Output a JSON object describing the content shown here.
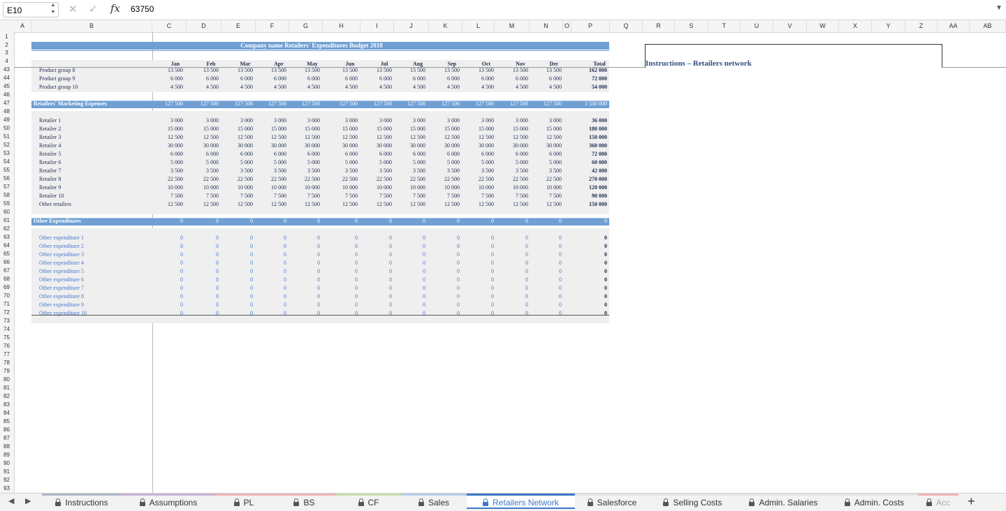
{
  "formula_bar": {
    "cell_ref": "E10",
    "fx": "fx",
    "value": "63750"
  },
  "columns": [
    "A",
    "B",
    "C",
    "D",
    "E",
    "F",
    "G",
    "H",
    "I",
    "J",
    "K",
    "L",
    "M",
    "N",
    "O",
    "P",
    "Q",
    "R",
    "S",
    "T",
    "U",
    "V",
    "W",
    "X",
    "Y",
    "Z",
    "AA",
    "AB",
    "AC"
  ],
  "row_numbers_top": [
    "1",
    "2",
    "3",
    "4"
  ],
  "row_numbers_main": [
    "43",
    "44",
    "45",
    "46",
    "47",
    "48",
    "49",
    "50",
    "51",
    "52",
    "53",
    "54",
    "55",
    "56",
    "57",
    "58",
    "59",
    "60",
    "61",
    "62",
    "63",
    "64",
    "65",
    "66",
    "67",
    "68",
    "69",
    "70",
    "71",
    "72",
    "73",
    "74",
    "75",
    "76",
    "77",
    "78",
    "79",
    "80",
    "81",
    "82",
    "83",
    "84",
    "85",
    "86",
    "87",
    "88",
    "89",
    "90",
    "91",
    "92",
    "93"
  ],
  "title": "Company name Retailers' Expenditures Budget 2018",
  "months": [
    "Jan",
    "Feb",
    "Mar",
    "Apr",
    "May",
    "Jun",
    "Jul",
    "Aug",
    "Sep",
    "Oct",
    "Nov",
    "Dec",
    "Total"
  ],
  "instructions_title": "Instructions – Retailers network",
  "product_rows": [
    {
      "label": "Product group 8",
      "values": [
        "13 500",
        "13 500",
        "13 500",
        "13 500",
        "13 500",
        "13 500",
        "13 500",
        "13 500",
        "13 500",
        "13 500",
        "13 500",
        "13 500",
        "162 000"
      ]
    },
    {
      "label": "Product group 9",
      "values": [
        "6 000",
        "6 000",
        "6 000",
        "6 000",
        "6 000",
        "6 000",
        "6 000",
        "6 000",
        "6 000",
        "6 000",
        "6 000",
        "6 000",
        "72 000"
      ]
    },
    {
      "label": "Product group 10",
      "values": [
        "4 500",
        "4 500",
        "4 500",
        "4 500",
        "4 500",
        "4 500",
        "4 500",
        "4 500",
        "4 500",
        "4 500",
        "4 500",
        "4 500",
        "54 000"
      ]
    }
  ],
  "marketing_header": {
    "label": "Retailers' Marketing Expenses",
    "values": [
      "127 500",
      "127 500",
      "127 500",
      "127 500",
      "127 500",
      "127 500",
      "127 500",
      "127 500",
      "127 500",
      "127 500",
      "127 500",
      "127 500",
      "1 530 000"
    ]
  },
  "retailer_rows": [
    {
      "label": "Retailer 1",
      "values": [
        "3 000",
        "3 000",
        "3 000",
        "3 000",
        "3 000",
        "3 000",
        "3 000",
        "3 000",
        "3 000",
        "3 000",
        "3 000",
        "3 000",
        "36 000"
      ]
    },
    {
      "label": "Retailer 2",
      "values": [
        "15 000",
        "15 000",
        "15 000",
        "15 000",
        "15 000",
        "15 000",
        "15 000",
        "15 000",
        "15 000",
        "15 000",
        "15 000",
        "15 000",
        "180 000"
      ]
    },
    {
      "label": "Retailer 3",
      "values": [
        "12 500",
        "12 500",
        "12 500",
        "12 500",
        "12 500",
        "12 500",
        "12 500",
        "12 500",
        "12 500",
        "12 500",
        "12 500",
        "12 500",
        "150 000"
      ]
    },
    {
      "label": "Retailer 4",
      "values": [
        "30 000",
        "30 000",
        "30 000",
        "30 000",
        "30 000",
        "30 000",
        "30 000",
        "30 000",
        "30 000",
        "30 000",
        "30 000",
        "30 000",
        "360 000"
      ]
    },
    {
      "label": "Retailer 5",
      "values": [
        "6 000",
        "6 000",
        "6 000",
        "6 000",
        "6 000",
        "6 000",
        "6 000",
        "6 000",
        "6 000",
        "6 000",
        "6 000",
        "6 000",
        "72 000"
      ]
    },
    {
      "label": "Retailer 6",
      "values": [
        "5 000",
        "5 000",
        "5 000",
        "5 000",
        "5 000",
        "5 000",
        "5 000",
        "5 000",
        "5 000",
        "5 000",
        "5 000",
        "5 000",
        "60 000"
      ]
    },
    {
      "label": "Retailer 7",
      "values": [
        "3 500",
        "3 500",
        "3 500",
        "3 500",
        "3 500",
        "3 500",
        "3 500",
        "3 500",
        "3 500",
        "3 500",
        "3 500",
        "3 500",
        "42 000"
      ]
    },
    {
      "label": "Retailer 8",
      "values": [
        "22 500",
        "22 500",
        "22 500",
        "22 500",
        "22 500",
        "22 500",
        "22 500",
        "22 500",
        "22 500",
        "22 500",
        "22 500",
        "22 500",
        "270 000"
      ]
    },
    {
      "label": "Retailer 9",
      "values": [
        "10 000",
        "10 000",
        "10 000",
        "10 000",
        "10 000",
        "10 000",
        "10 000",
        "10 000",
        "10 000",
        "10 000",
        "10 000",
        "10 000",
        "120 000"
      ]
    },
    {
      "label": "Retailer 10",
      "values": [
        "7 500",
        "7 500",
        "7 500",
        "7 500",
        "7 500",
        "7 500",
        "7 500",
        "7 500",
        "7 500",
        "7 500",
        "7 500",
        "7 500",
        "90 000"
      ]
    },
    {
      "label": "Other retailers",
      "values": [
        "12 500",
        "12 500",
        "12 500",
        "12 500",
        "12 500",
        "12 500",
        "12 500",
        "12 500",
        "12 500",
        "12 500",
        "12 500",
        "12 500",
        "150 000"
      ]
    }
  ],
  "other_header": {
    "label": "Other Expenditures",
    "values": [
      "0",
      "0",
      "0",
      "0",
      "0",
      "0",
      "0",
      "0",
      "0",
      "0",
      "0",
      "0",
      "0"
    ]
  },
  "other_rows": [
    {
      "label": "Other expenditure 1",
      "values": [
        "0",
        "0",
        "0",
        "0",
        "0",
        "0",
        "0",
        "0",
        "0",
        "0",
        "0",
        "0",
        "0"
      ]
    },
    {
      "label": "Other expenditure 2",
      "values": [
        "0",
        "0",
        "0",
        "0",
        "0",
        "0",
        "0",
        "0",
        "0",
        "0",
        "0",
        "0",
        "0"
      ]
    },
    {
      "label": "Other expenditure 3",
      "values": [
        "0",
        "0",
        "0",
        "0",
        "0",
        "0",
        "0",
        "0",
        "0",
        "0",
        "0",
        "0",
        "0"
      ]
    },
    {
      "label": "Other expenditure 4",
      "values": [
        "0",
        "0",
        "0",
        "0",
        "0",
        "0",
        "0",
        "0",
        "0",
        "0",
        "0",
        "0",
        "0"
      ]
    },
    {
      "label": "Other expenditure 5",
      "values": [
        "0",
        "0",
        "0",
        "0",
        "0",
        "0",
        "0",
        "0",
        "0",
        "0",
        "0",
        "0",
        "0"
      ]
    },
    {
      "label": "Other expenditure 6",
      "values": [
        "0",
        "0",
        "0",
        "0",
        "0",
        "0",
        "0",
        "0",
        "0",
        "0",
        "0",
        "0",
        "0"
      ]
    },
    {
      "label": "Other expenditure 7",
      "values": [
        "0",
        "0",
        "0",
        "0",
        "0",
        "0",
        "0",
        "0",
        "0",
        "0",
        "0",
        "0",
        "0"
      ]
    },
    {
      "label": "Other expenditure 8",
      "values": [
        "0",
        "0",
        "0",
        "0",
        "0",
        "0",
        "0",
        "0",
        "0",
        "0",
        "0",
        "0",
        "0"
      ]
    },
    {
      "label": "Other expenditure 9",
      "values": [
        "0",
        "0",
        "0",
        "0",
        "0",
        "0",
        "0",
        "0",
        "0",
        "0",
        "0",
        "0",
        "0"
      ]
    },
    {
      "label": "Other expenditure 10",
      "values": [
        "0",
        "0",
        "0",
        "0",
        "0",
        "0",
        "0",
        "0",
        "0",
        "0",
        "0",
        "0",
        "0"
      ]
    }
  ],
  "tabs": [
    {
      "label": "Instructions",
      "active": false
    },
    {
      "label": "Assumptions",
      "active": false
    },
    {
      "label": "PL",
      "active": false
    },
    {
      "label": "BS",
      "active": false
    },
    {
      "label": "CF",
      "active": false
    },
    {
      "label": "Sales",
      "active": false
    },
    {
      "label": "Retailers Network",
      "active": true
    },
    {
      "label": "Salesforce",
      "active": false
    },
    {
      "label": "Selling Costs",
      "active": false
    },
    {
      "label": "Admin. Salaries",
      "active": false
    },
    {
      "label": "Admin. Costs",
      "active": false
    },
    {
      "label": "Acc",
      "active": false
    }
  ],
  "add_sheet_label": "+",
  "colors": {
    "band": "#6f9fd3",
    "text": "#1f2d4d",
    "input_blue": "#4478d1",
    "active_tab": "#3e78c8",
    "selected_col": "#1f8a4c"
  }
}
